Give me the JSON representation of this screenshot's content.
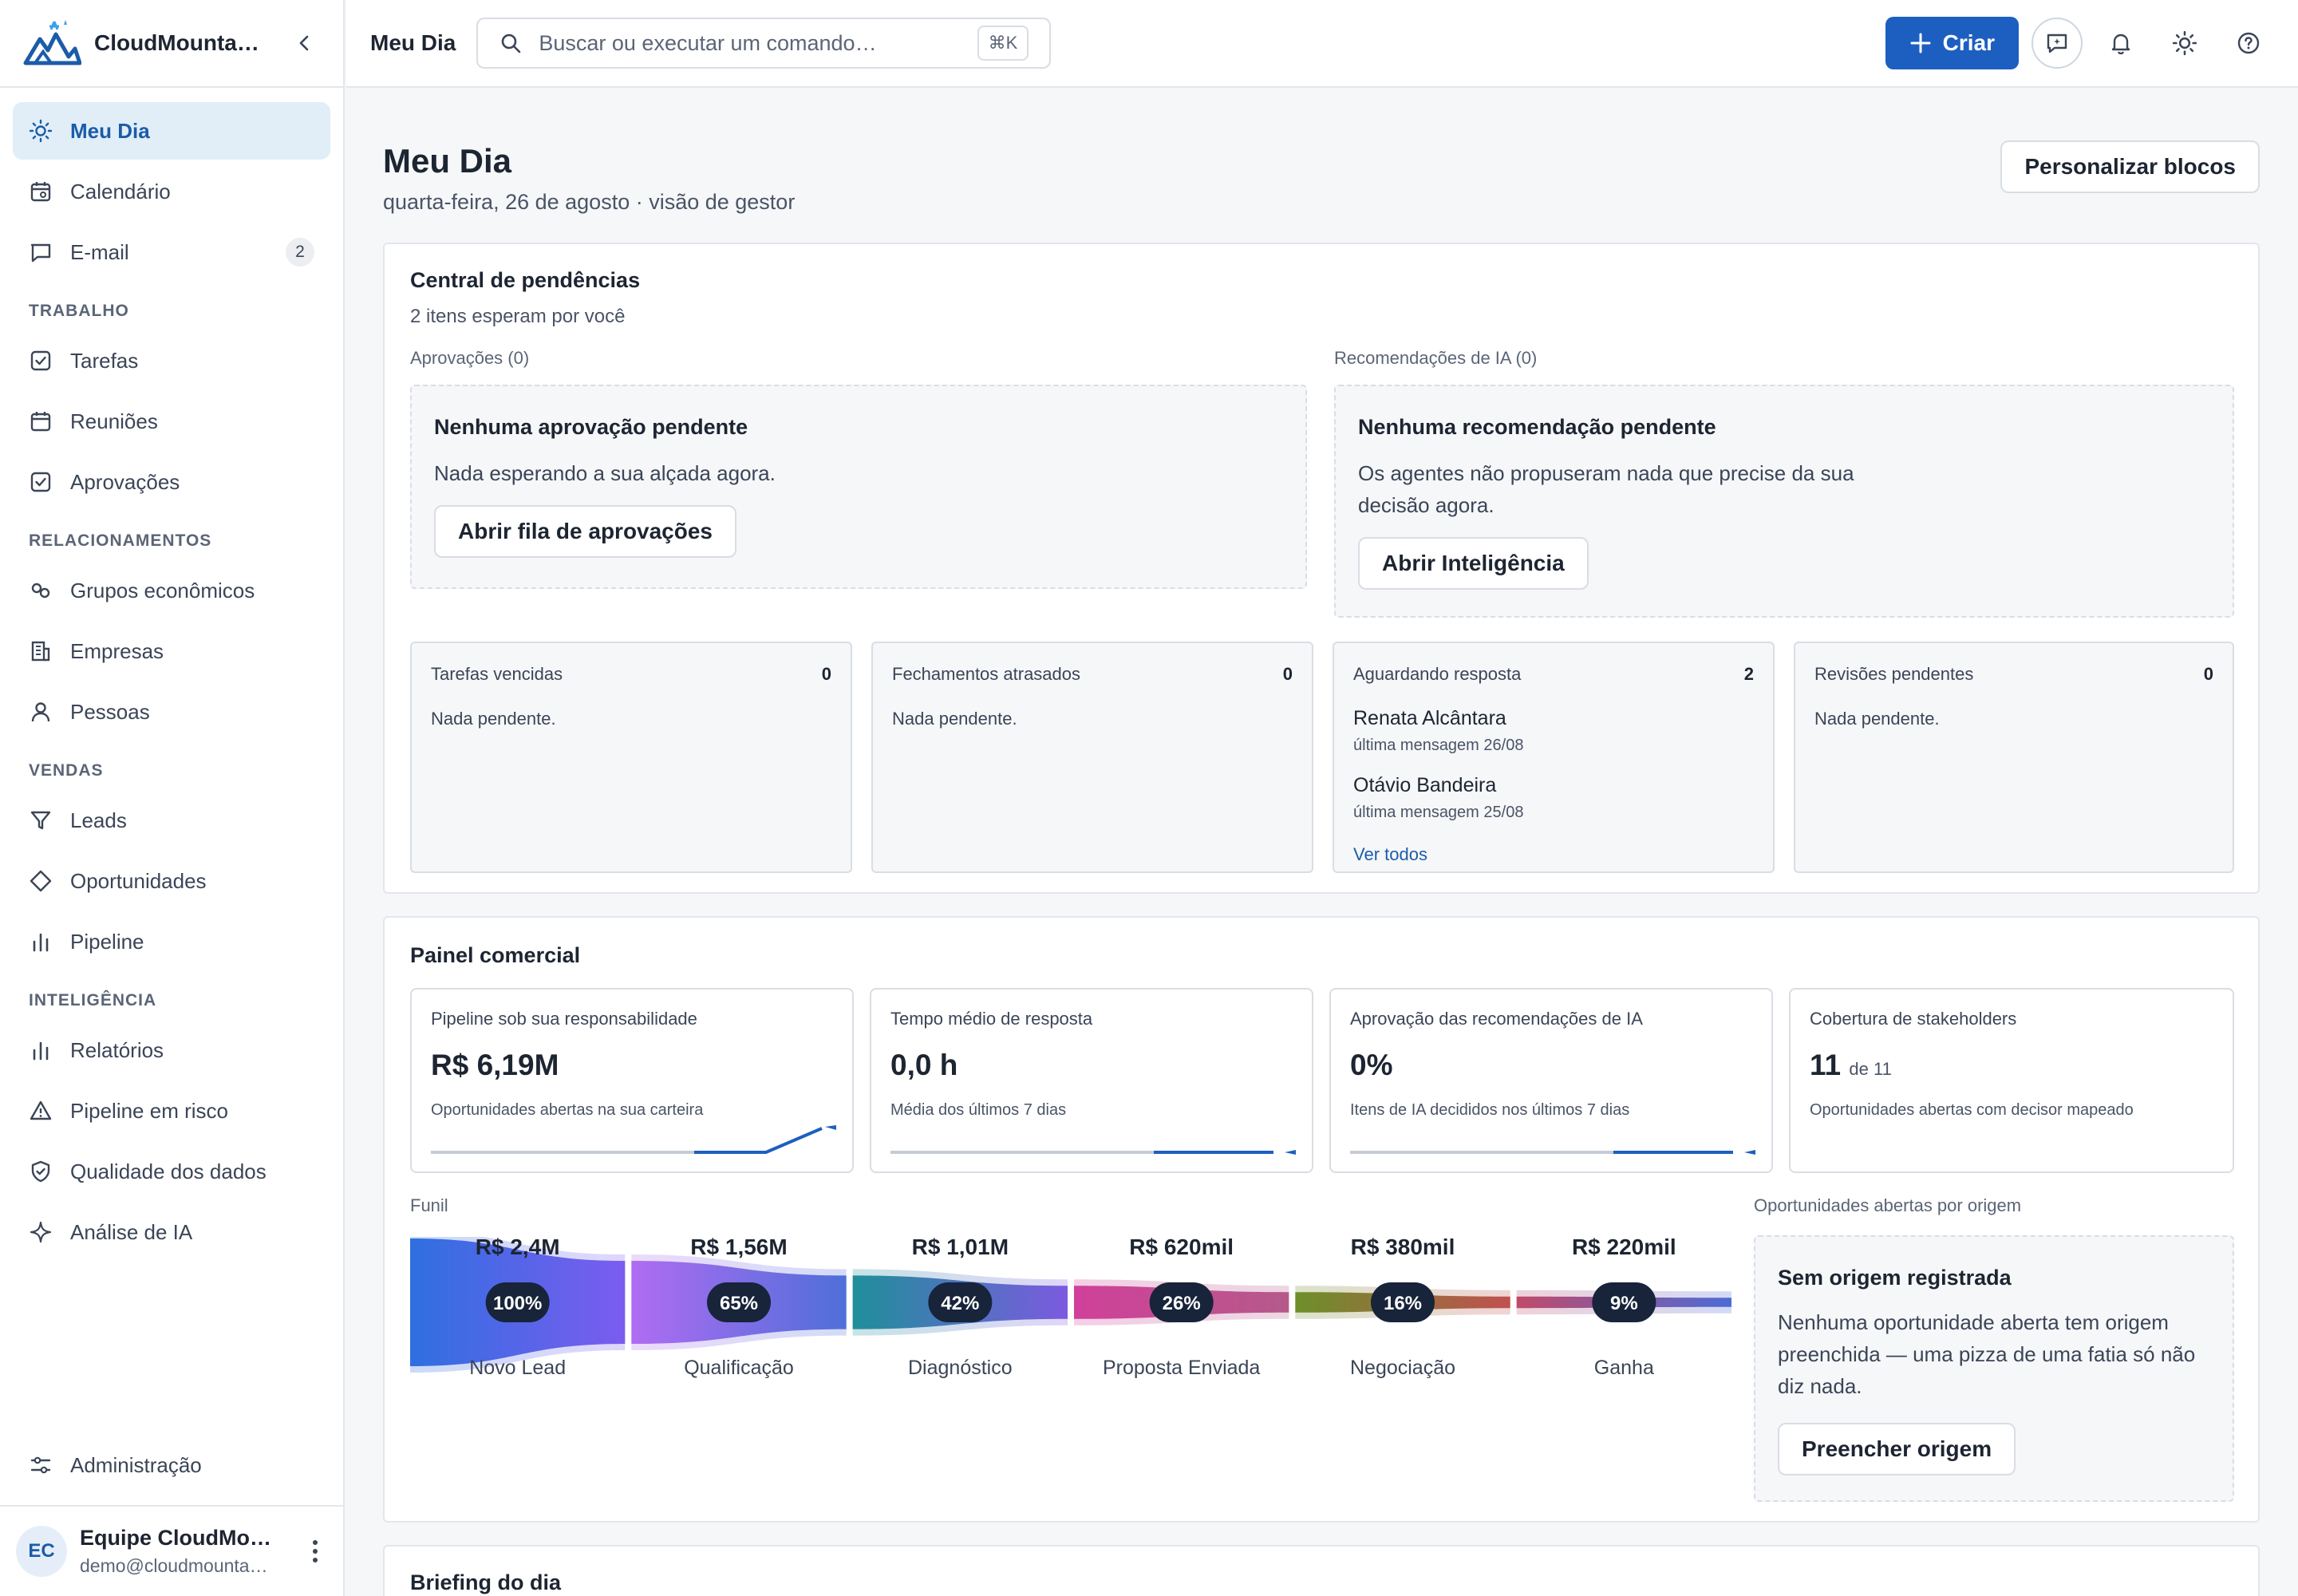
{
  "brand": {
    "name": "CloudMountai…"
  },
  "sidebar": {
    "items": [
      {
        "label": "Meu Dia",
        "icon": "sun-icon",
        "active": true
      },
      {
        "label": "Calendário",
        "icon": "calendar-icon"
      },
      {
        "label": "E-mail",
        "icon": "message-icon",
        "badge": "2"
      }
    ],
    "sections": [
      {
        "title": "TRABALHO",
        "items": [
          {
            "label": "Tarefas",
            "icon": "check-square-icon"
          },
          {
            "label": "Reuniões",
            "icon": "calendar-icon"
          },
          {
            "label": "Aprovações",
            "icon": "check-square-icon"
          }
        ]
      },
      {
        "title": "RELACIONAMENTOS",
        "items": [
          {
            "label": "Grupos econômicos",
            "icon": "link-icon"
          },
          {
            "label": "Empresas",
            "icon": "building-icon"
          },
          {
            "label": "Pessoas",
            "icon": "user-icon"
          }
        ]
      },
      {
        "title": "VENDAS",
        "items": [
          {
            "label": "Leads",
            "icon": "filter-icon"
          },
          {
            "label": "Oportunidades",
            "icon": "diamond-icon"
          },
          {
            "label": "Pipeline",
            "icon": "bar-chart-icon"
          }
        ]
      },
      {
        "title": "INTELIGÊNCIA",
        "items": [
          {
            "label": "Relatórios",
            "icon": "bar-chart-icon"
          },
          {
            "label": "Pipeline em risco",
            "icon": "warning-icon"
          },
          {
            "label": "Qualidade dos dados",
            "icon": "shield-check-icon"
          },
          {
            "label": "Análise de IA",
            "icon": "sparkle-icon"
          }
        ]
      }
    ],
    "admin": {
      "label": "Administração",
      "icon": "sliders-icon"
    },
    "user": {
      "initials": "EC",
      "name": "Equipe CloudMo…",
      "email": "demo@cloudmounta…"
    }
  },
  "topbar": {
    "title": "Meu Dia",
    "search_placeholder": "Buscar ou executar um comando…",
    "shortcut": "⌘K",
    "create_label": "Criar"
  },
  "page": {
    "title": "Meu Dia",
    "subtitle": "quarta-feira, 26 de agosto · visão de gestor",
    "customize_label": "Personalizar blocos"
  },
  "pending": {
    "title": "Central de pendências",
    "subtitle": "2 itens esperam por você",
    "approvals": {
      "label": "Aprovações (0)",
      "empty_title": "Nenhuma aprovação pendente",
      "empty_text": "Nada esperando a sua alçada agora.",
      "button": "Abrir fila de aprovações"
    },
    "recommendations": {
      "label": "Recomendações de IA (0)",
      "empty_title": "Nenhuma recomendação pendente",
      "empty_text_1": "Os agentes não propuseram nada que precise da sua",
      "empty_text_2": "decisão agora.",
      "button": "Abrir Inteligência"
    },
    "mini": [
      {
        "label": "Tarefas vencidas",
        "count": "0",
        "empty": "Nada pendente."
      },
      {
        "label": "Fechamentos atrasados",
        "count": "0",
        "empty": "Nada pendente."
      },
      {
        "label": "Aguardando resposta",
        "count": "2",
        "people": [
          {
            "name": "Renata Alcântara",
            "meta": "última mensagem 26/08"
          },
          {
            "name": "Otávio Bandeira",
            "meta": "última mensagem 25/08"
          }
        ],
        "link": "Ver todos"
      },
      {
        "label": "Revisões pendentes",
        "count": "0",
        "empty": "Nada pendente."
      }
    ]
  },
  "commercial": {
    "title": "Painel comercial",
    "kpis": [
      {
        "label": "Pipeline sob sua responsabilidade",
        "value": "R$ 6,19M",
        "desc": "Oportunidades abertas na sua carteira"
      },
      {
        "label": "Tempo médio de resposta",
        "value": "0,0 h",
        "desc": "Média dos últimos 7 dias"
      },
      {
        "label": "Aprovação das recomendações de IA",
        "value": "0%",
        "desc": "Itens de IA decididos nos últimos 7 dias"
      },
      {
        "label": "Cobertura de stakeholders",
        "value": "11",
        "value_suffix": "de 11",
        "desc": "Oportunidades abertas com decisor mapeado"
      }
    ],
    "funnel_label": "Funil",
    "origin_label": "Oportunidades abertas por origem",
    "origin": {
      "empty_title": "Sem origem registrada",
      "empty_text_1": "Nenhuma oportunidade aberta tem origem",
      "empty_text_2": "preenchida — uma pizza de uma fatia só não",
      "empty_text_3": "diz nada.",
      "button": "Preencher origem"
    }
  },
  "chart_data": {
    "type": "bar",
    "title": "Funil",
    "categories": [
      "Novo Lead",
      "Qualificação",
      "Diagnóstico",
      "Proposta Enviada",
      "Negociação",
      "Ganha"
    ],
    "value_labels": [
      "R$ 2,4M",
      "R$ 1,56M",
      "R$ 1,01M",
      "R$ 620mil",
      "R$ 380mil",
      "R$ 220mil"
    ],
    "values": [
      2400000,
      1560000,
      1010000,
      620000,
      380000,
      220000
    ],
    "percent_labels": [
      "100%",
      "65%",
      "42%",
      "26%",
      "16%",
      "9%"
    ],
    "percents": [
      100,
      65,
      42,
      26,
      16,
      9
    ],
    "colors": [
      [
        "#2f6fe0",
        "#7b5cf0"
      ],
      [
        "#b06cf2",
        "#4e6fd9"
      ],
      [
        "#1f8f9a",
        "#7c5ae0"
      ],
      [
        "#d0409a",
        "#b55a8a"
      ],
      [
        "#6d8f2a",
        "#c0504f"
      ],
      [
        "#c04a6a",
        "#4c6bd6"
      ]
    ]
  },
  "next_section": {
    "title": "Briefing do dia"
  }
}
